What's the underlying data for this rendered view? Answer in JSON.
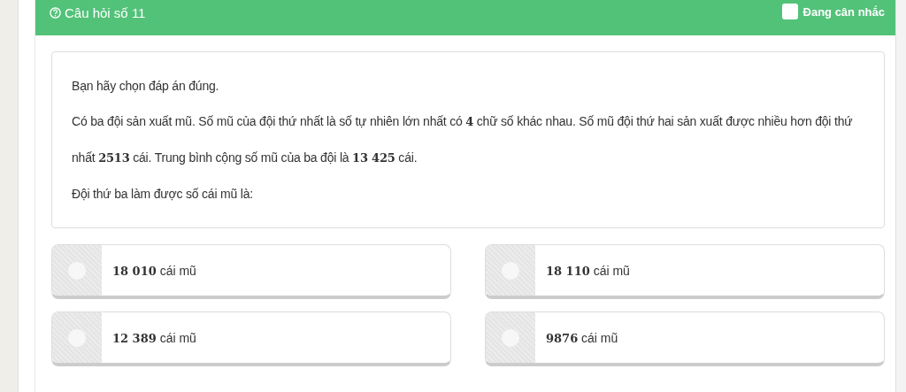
{
  "header": {
    "title": "Câu hỏi số 11",
    "flag": {
      "label": "Đang cân nhắc",
      "checked": false
    }
  },
  "question": {
    "lines": [
      "Bạn hãy chọn đáp án đúng.",
      "Có ba đội sản xuất mũ. Số mũ của đội thứ nhất là số tự nhiên lớn nhất có **4** chữ số khác nhau. Số mũ đội thứ hai sản xuất được nhiều hơn đội thứ nhất **2513** cái. Trung bình cộng số mũ của ba đội là **13 425** cái.",
      "Đội thứ ba làm được số cái mũ là:"
    ]
  },
  "options": [
    {
      "label": "**18 010** cái mũ",
      "selected": false
    },
    {
      "label": "**18 110** cái mũ",
      "selected": false
    },
    {
      "label": "**12 389** cái mũ",
      "selected": false
    },
    {
      "label": "**9876** cái mũ",
      "selected": false
    }
  ]
}
